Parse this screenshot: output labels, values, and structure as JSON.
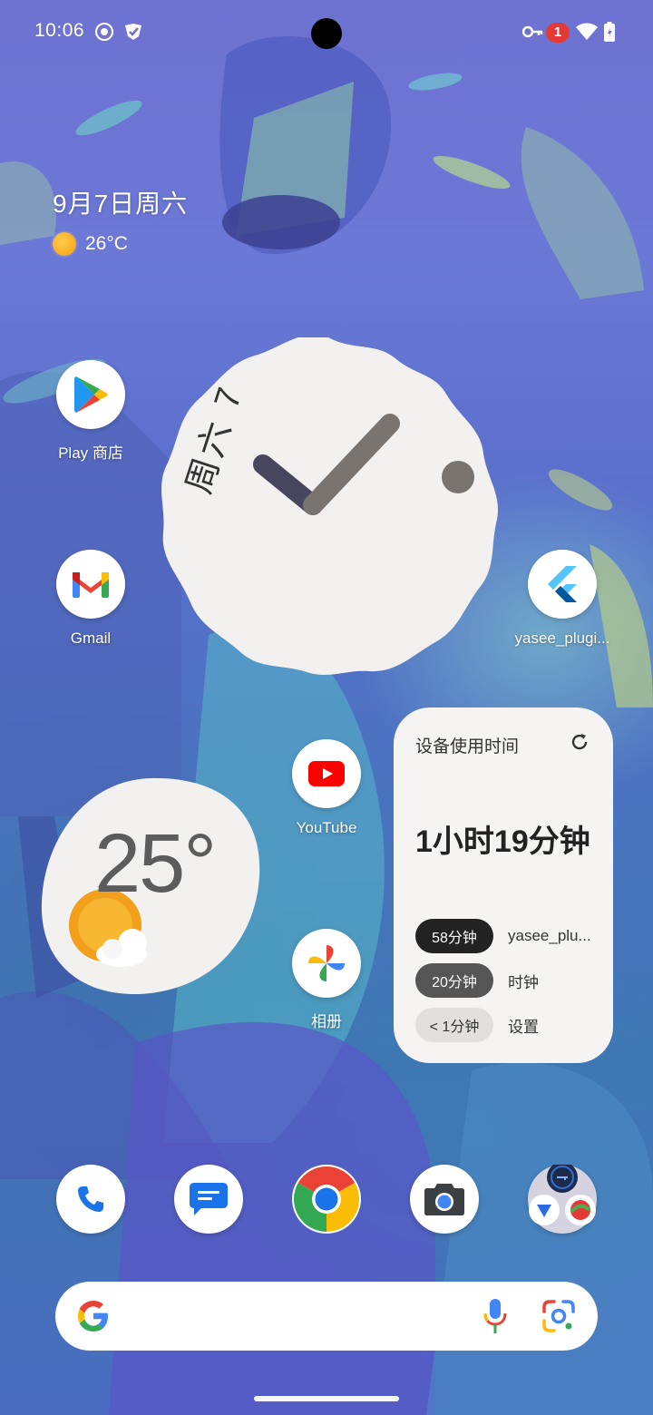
{
  "status_bar": {
    "time": "10:06",
    "notification_count": "1",
    "icons": [
      "hotspot-icon",
      "check-shield-icon",
      "vpn-key-icon",
      "wifi-icon",
      "battery-icon"
    ]
  },
  "at_a_glance": {
    "date": "9月7日周六",
    "temperature": "26°C"
  },
  "apps": {
    "play_store": "Play 商店",
    "gmail": "Gmail",
    "flutter_app": "yasee_plugi...",
    "youtube": "YouTube",
    "photos": "相册"
  },
  "clock_widget": {
    "date_label": "周六 7"
  },
  "weather_widget": {
    "temperature": "25°"
  },
  "screen_time_widget": {
    "title": "设备使用时间",
    "total": "1小时19分钟",
    "rows": [
      {
        "duration": "58分钟",
        "app": "yasee_plu...",
        "pill_color": "#222222",
        "text_color": "#ffffff"
      },
      {
        "duration": "20分钟",
        "app": "时钟",
        "pill_color": "#555555",
        "text_color": "#ffffff"
      },
      {
        "duration": "< 1分钟",
        "app": "设置",
        "pill_color": "#e2e0de",
        "text_color": "#333333"
      }
    ]
  },
  "dock": [
    "phone-icon",
    "messages-icon",
    "chrome-icon",
    "camera-icon",
    "folder-icon"
  ],
  "colors": {
    "accent_blue": "#4285f4",
    "google_red": "#ea4335",
    "google_yellow": "#fbbc05",
    "google_green": "#34a853"
  }
}
